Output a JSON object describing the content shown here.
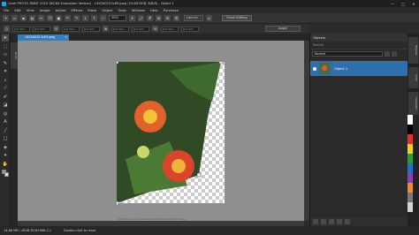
{
  "window": {
    "title": "Corel PHOTO-PAINT 2019 (64-Bit Evaluation Version) - 1452b023-fc69.jpeg (24-Bit RGB, 8/8/8) - Object 1",
    "controls": [
      "—",
      "□",
      "✕"
    ]
  },
  "menu": [
    "File",
    "Edit",
    "View",
    "Image",
    "Adjust",
    "Effects",
    "Mask",
    "Object",
    "Tools",
    "Window",
    "Help",
    "Purchase"
  ],
  "toolbar": {
    "zoom_value": "50%",
    "launch_label": "Launch",
    "finish_label": "Finish Editing"
  },
  "propbar": {
    "fields": [
      "0.0 mm",
      "0.0 mm",
      "0.0 mm",
      "0.0 mm",
      "0.0 mm",
      "0.0 mm",
      "0.0 mm",
      "0.0 mm"
    ],
    "apply_label": "Apply"
  },
  "document_tab": {
    "name": "1452b023-fc69.jpeg",
    "close": "×"
  },
  "canvas": {
    "hint": "Drag the corner handles to distort the object shape"
  },
  "status": {
    "doc_info": "14.86 MB / sRGB IEC61966-2.1",
    "hint": "Double-click to reset"
  },
  "objects_panel": {
    "title": "Objects",
    "search_placeholder": "Search",
    "blend_mode": "Normal",
    "objects": [
      {
        "name": "Object 1",
        "selected": true
      }
    ]
  },
  "side_tab": "Hints",
  "dock_tabs": [
    "Objects",
    "Color",
    "Channels"
  ],
  "palette": [
    "#ffffff",
    "#000000",
    "#e4322b",
    "#f7d117",
    "#2a9d3a",
    "#1f6fd1",
    "#8b3fb2",
    "#f08a24",
    "#7a7a7a",
    "#d4d4d4"
  ]
}
